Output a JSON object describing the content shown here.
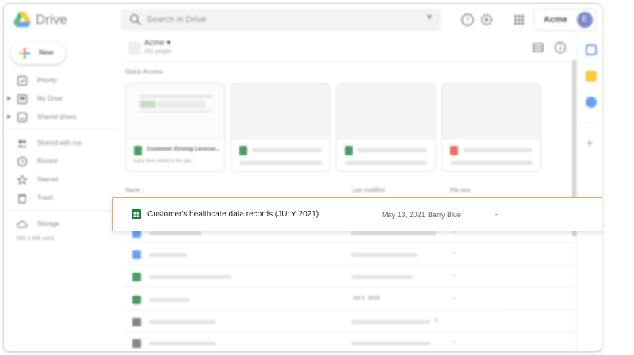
{
  "app": {
    "name": "Drive"
  },
  "search": {
    "placeholder": "Search in Drive"
  },
  "account": {
    "org": "Acme",
    "avatar_letter": "E"
  },
  "sidebar": {
    "new_label": "New",
    "items": [
      {
        "label": "Priority",
        "icon": "priority-icon"
      },
      {
        "label": "My Drive",
        "icon": "my-drive-icon"
      },
      {
        "label": "Shared drives",
        "icon": "shared-drives-icon"
      },
      {
        "label": "Shared with me",
        "icon": "shared-with-me-icon"
      },
      {
        "label": "Recent",
        "icon": "clock-icon"
      },
      {
        "label": "Starred",
        "icon": "star-icon"
      },
      {
        "label": "Trash",
        "icon": "trash-icon"
      },
      {
        "label": "Storage",
        "icon": "cloud-icon"
      }
    ],
    "storage_used": "665.3 MB used"
  },
  "main": {
    "org_name": "Acme",
    "org_people": "231 people",
    "quick_access": "Quick Access",
    "cards": [
      {
        "title": "Customer Driving License...",
        "sub": "barry blue edited in the pas..."
      }
    ],
    "columns": {
      "name": "Name",
      "last_modified": "Last modified",
      "file_size": "File size"
    },
    "rows": [
      {
        "date": "",
        "size": "–"
      },
      {
        "date": "",
        "size": "–"
      },
      {
        "date": "",
        "size": "–"
      },
      {
        "date": "Jul 2, 2020",
        "size": "–"
      },
      {
        "date": "",
        "size": "1"
      },
      {
        "date": "",
        "size": "–"
      }
    ]
  },
  "highlight": {
    "name": "Customer's healthcare data records (JULY 2021)",
    "date": "May 13, 2021",
    "owner": "Barry Blue",
    "size": "–"
  },
  "colors": {
    "sheet": "#188038",
    "doc": "#4285f4",
    "highlight_border": "#f0a868",
    "avatar": "#5c6bc0"
  }
}
